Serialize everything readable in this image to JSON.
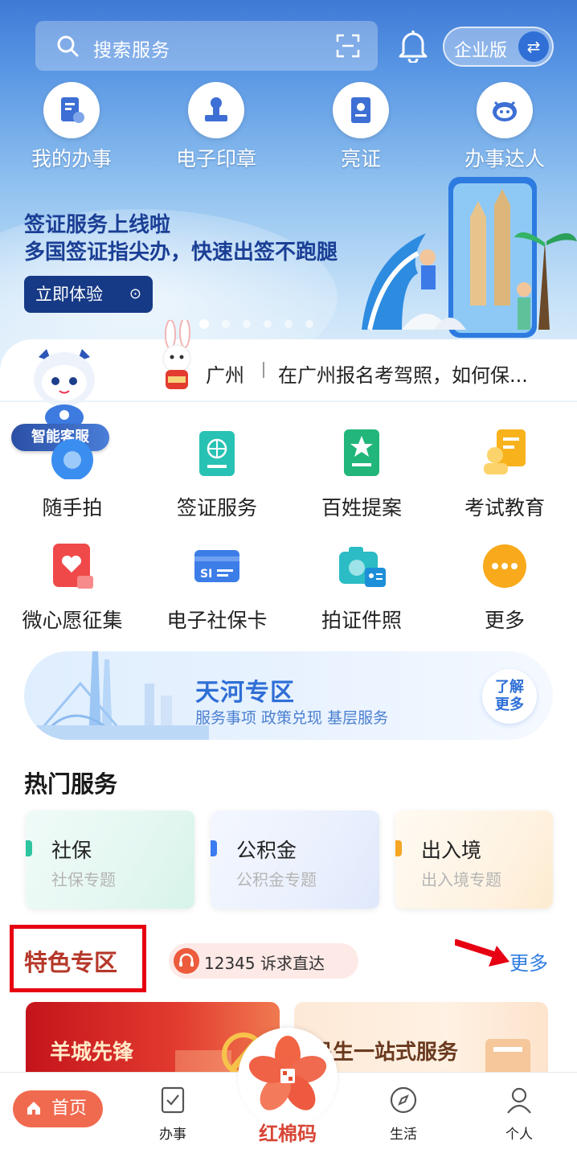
{
  "search": {
    "placeholder": "搜索服务",
    "biz_label": "企业版"
  },
  "quick_actions": [
    {
      "label": "我的办事"
    },
    {
      "label": "电子印章"
    },
    {
      "label": "亮证"
    },
    {
      "label": "办事达人"
    }
  ],
  "banner": {
    "title": "签证服务上线啦",
    "subtitle": "多国签证指尖办，快速出签不跑腿",
    "button": "立即体验"
  },
  "news": {
    "city": "广州",
    "text": "在广州报名考驾照，如何保..."
  },
  "assistant": {
    "label": "智能客服"
  },
  "services": [
    {
      "label": "随手拍"
    },
    {
      "label": "签证服务"
    },
    {
      "label": "百姓提案"
    },
    {
      "label": "考试教育"
    },
    {
      "label": "微心愿征集"
    },
    {
      "label": "电子社保卡"
    },
    {
      "label": "拍证件照"
    },
    {
      "label": "更多"
    }
  ],
  "tianhe": {
    "title": "天河专区",
    "subtitle": "服务事项  政策兑现  基层服务",
    "more_line1": "了解",
    "more_line2": "更多"
  },
  "hot": {
    "title": "热门服务",
    "cards": [
      {
        "title": "社保",
        "sub": "社保专题",
        "accent": "#2ec4a0"
      },
      {
        "title": "公积金",
        "sub": "公积金专题",
        "accent": "#3b7bf0"
      },
      {
        "title": "出入境",
        "sub": "出入境专题",
        "accent": "#f5a623"
      }
    ]
  },
  "featured": {
    "title": "特色专区",
    "hotline": "12345 诉求直达",
    "more": "更多",
    "promos": [
      {
        "title": "羊城先锋"
      },
      {
        "title": "民生一站式服务"
      }
    ]
  },
  "tabbar": {
    "home": "首页",
    "affairs": "办事",
    "center": "红棉码",
    "life": "生活",
    "personal": "个人"
  }
}
